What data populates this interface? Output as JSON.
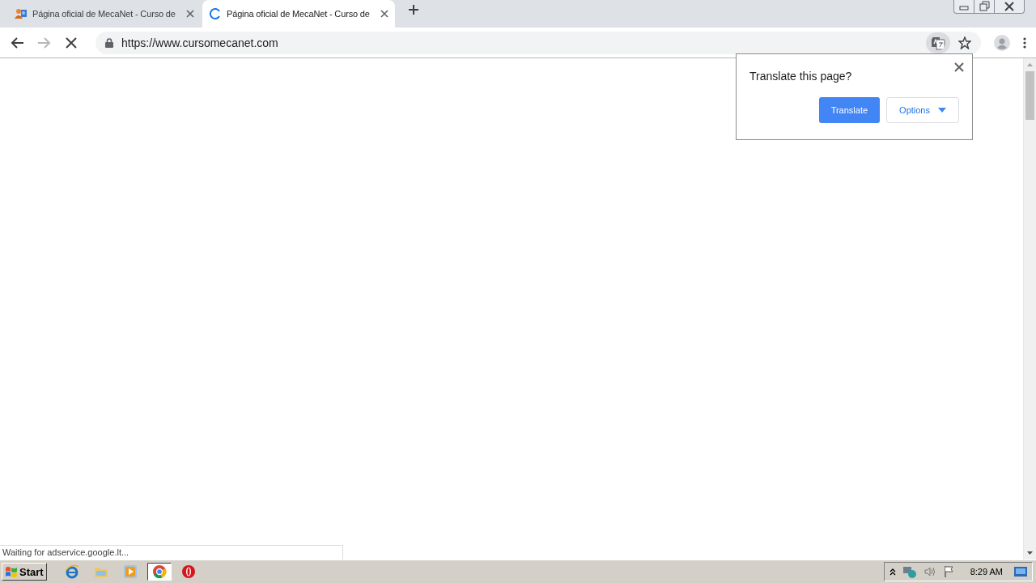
{
  "tabs": [
    {
      "title": "Página oficial de MecaNet - Curso de",
      "selected": false,
      "loading": false
    },
    {
      "title": "Página oficial de MecaNet - Curso de",
      "selected": true,
      "loading": true
    }
  ],
  "toolbar": {
    "url": "https://www.cursomecanet.com",
    "loading": true
  },
  "translate_popup": {
    "title": "Translate this page?",
    "buttons": [
      {
        "label": "Translate",
        "kind": "primary"
      },
      {
        "label": "Options",
        "kind": "dropdown"
      }
    ]
  },
  "status_bubble": "Waiting for adservice.google.lt...",
  "taskbar": {
    "start": "Start",
    "apps": [
      {
        "kind": "ie",
        "selected": false
      },
      {
        "kind": "folder",
        "selected": false
      },
      {
        "kind": "media",
        "selected": false
      },
      {
        "kind": "chrome",
        "selected": true
      },
      {
        "kind": "opera",
        "selected": false
      }
    ],
    "clock": "8:29 AM"
  }
}
